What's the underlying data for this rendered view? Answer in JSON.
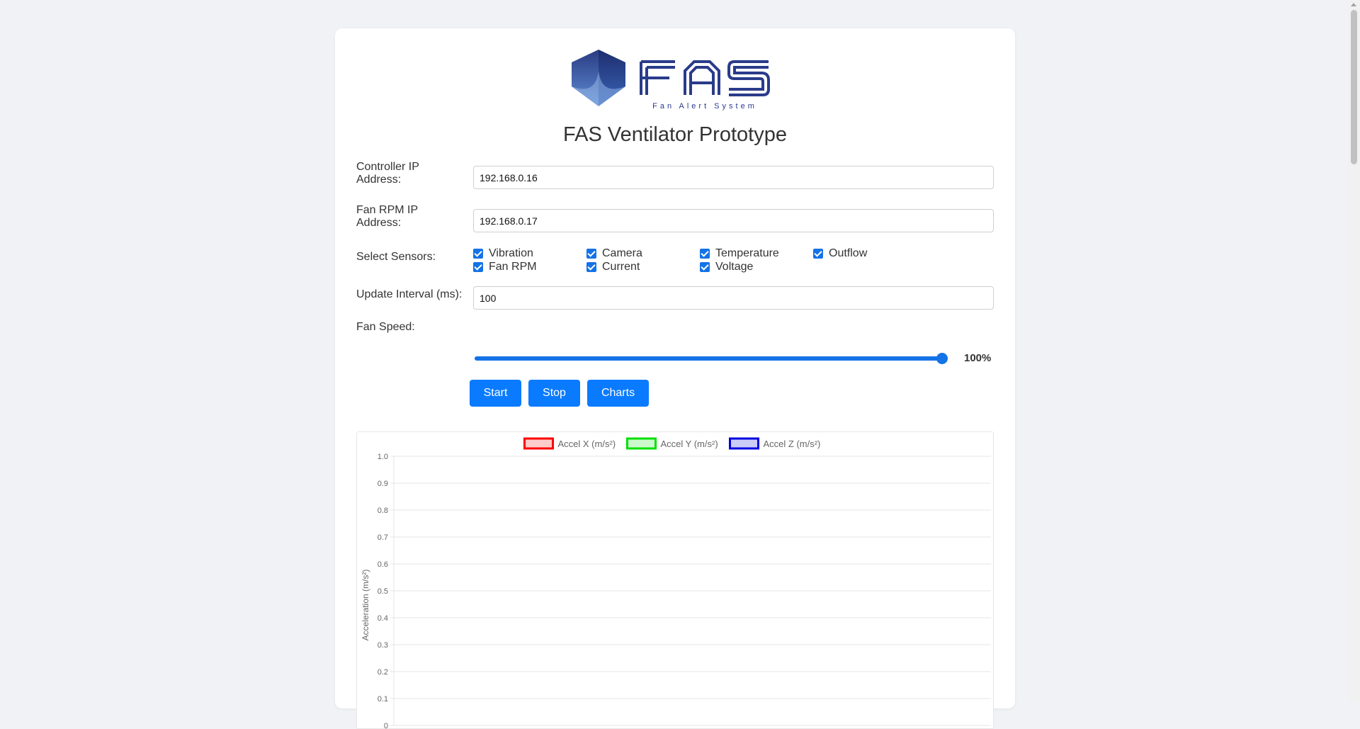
{
  "logo": {
    "text": "FAS",
    "tagline": "Fan Alert System"
  },
  "page_title": "FAS Ventilator Prototype",
  "form": {
    "controller_ip": {
      "label": "Controller IP Address:",
      "value": "192.168.0.16"
    },
    "fan_rpm_ip": {
      "label": "Fan RPM IP Address:",
      "value": "192.168.0.17"
    },
    "sensors": {
      "label": "Select Sensors:",
      "items": [
        {
          "label": "Vibration",
          "checked": true
        },
        {
          "label": "Camera",
          "checked": true
        },
        {
          "label": "Temperature",
          "checked": true
        },
        {
          "label": "Outflow",
          "checked": true
        },
        {
          "label": "Fan RPM",
          "checked": true
        },
        {
          "label": "Current",
          "checked": true
        },
        {
          "label": "Voltage",
          "checked": true
        }
      ]
    },
    "update_interval": {
      "label": "Update Interval (ms):",
      "value": "100"
    },
    "fan_speed": {
      "label": "Fan Speed:",
      "value": 100,
      "display": "100%"
    }
  },
  "buttons": {
    "start": "Start",
    "stop": "Stop",
    "charts": "Charts"
  },
  "colors": {
    "accent": "#0a7bff",
    "accel_x": "#ff0000",
    "accel_y": "#00e000",
    "accel_z": "#0000e0"
  },
  "chart_data": {
    "type": "line",
    "ylabel": "Acceleration (m/s²)",
    "xlabel": "",
    "ylim": [
      0,
      1.0
    ],
    "y_ticks": [
      "1.0",
      "0.9",
      "0.8",
      "0.7",
      "0.6",
      "0.5",
      "0.4",
      "0.3",
      "0.2",
      "0.1",
      "0"
    ],
    "grid": true,
    "legend_position": "top-center",
    "series": [
      {
        "name": "Accel X (m/s²)",
        "values": []
      },
      {
        "name": "Accel Y (m/s²)",
        "values": []
      },
      {
        "name": "Accel Z (m/s²)",
        "values": []
      }
    ]
  }
}
